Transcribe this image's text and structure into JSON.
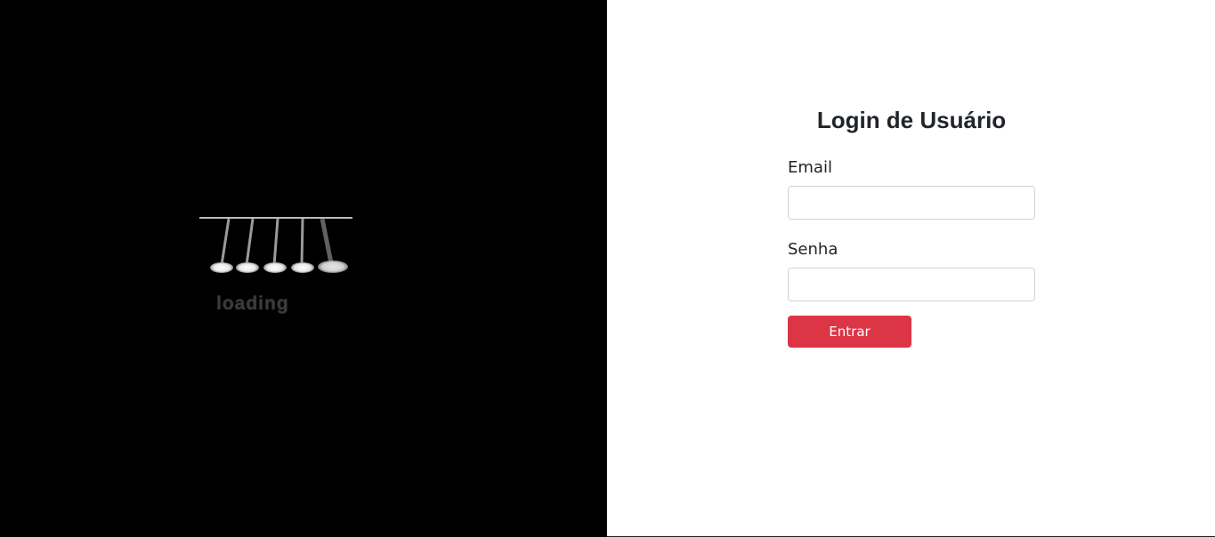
{
  "loader": {
    "text": "loading",
    "icon": "newtons-cradle-icon"
  },
  "login": {
    "title": "Login de Usuário",
    "email_label": "Email",
    "email_value": "",
    "password_label": "Senha",
    "password_value": "",
    "submit_label": "Entrar"
  },
  "colors": {
    "left_background": "#000000",
    "button_accent": "#dc3545"
  }
}
